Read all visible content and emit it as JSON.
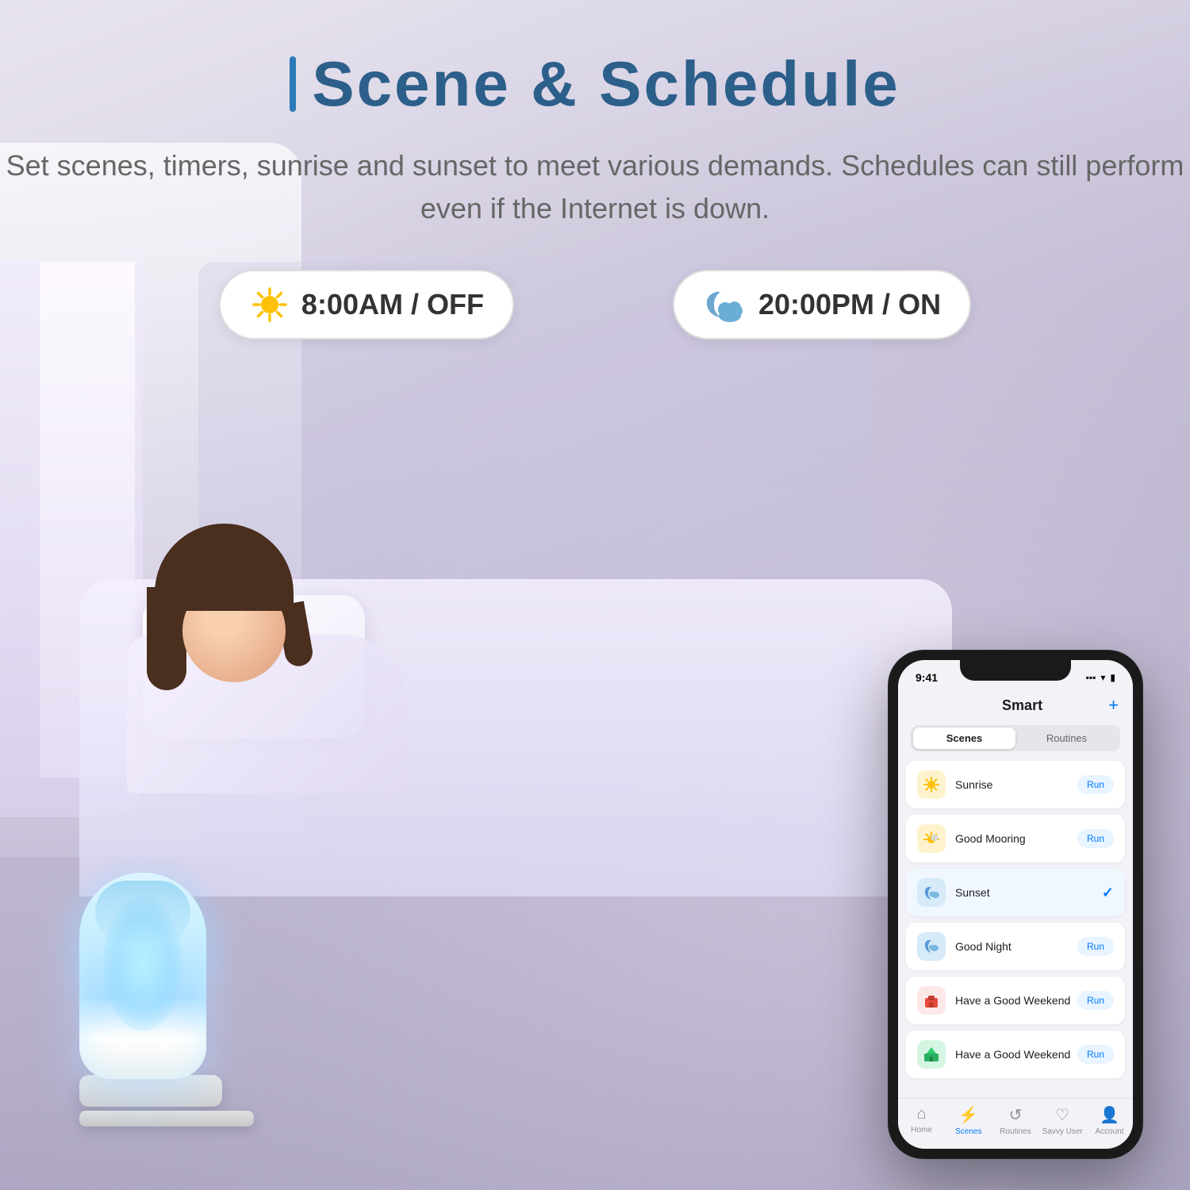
{
  "page": {
    "title": "Scene & Schedule",
    "title_prefix": "I",
    "subtitle": "Set scenes, timers, sunrise and sunset to meet various demands. Schedules can still perform even if the Internet is down."
  },
  "schedule": {
    "morning": {
      "time": "8:00AM",
      "status": "OFF",
      "icon": "sun"
    },
    "evening": {
      "time": "20:00PM",
      "status": "ON",
      "icon": "moon-cloud"
    }
  },
  "phone": {
    "status_time": "9:41",
    "app_title": "Smart",
    "add_btn": "+",
    "tabs": [
      "Scenes",
      "Routines"
    ],
    "active_tab": "Scenes",
    "scenes": [
      {
        "name": "Sunrise",
        "icon": "🌅",
        "icon_bg": "#fff3cd",
        "action": "Run"
      },
      {
        "name": "Good Mooring",
        "icon": "🌤️",
        "icon_bg": "#fff3cd",
        "action": "Run"
      },
      {
        "name": "Sunset",
        "icon": "🌙",
        "icon_bg": "#d6eaf8",
        "action": "check",
        "active": true
      },
      {
        "name": "Good Night",
        "icon": "☁️",
        "icon_bg": "#d6eaf8",
        "action": "Run"
      },
      {
        "name": "Have a Good Weekend",
        "icon": "🏠",
        "icon_bg": "#fde8e8",
        "action": "Run"
      },
      {
        "name": "Have a Good Weekend",
        "icon": "🌿",
        "icon_bg": "#d5f5e3",
        "action": "Run"
      }
    ],
    "bottom_nav": [
      {
        "icon": "🏠",
        "label": "Home",
        "active": false
      },
      {
        "icon": "⚡",
        "label": "Scenes",
        "active": true
      },
      {
        "icon": "🔄",
        "label": "Routines",
        "active": false
      },
      {
        "icon": "♡",
        "label": "Savvy User",
        "active": false
      },
      {
        "icon": "👤",
        "label": "Account",
        "active": false
      }
    ]
  }
}
